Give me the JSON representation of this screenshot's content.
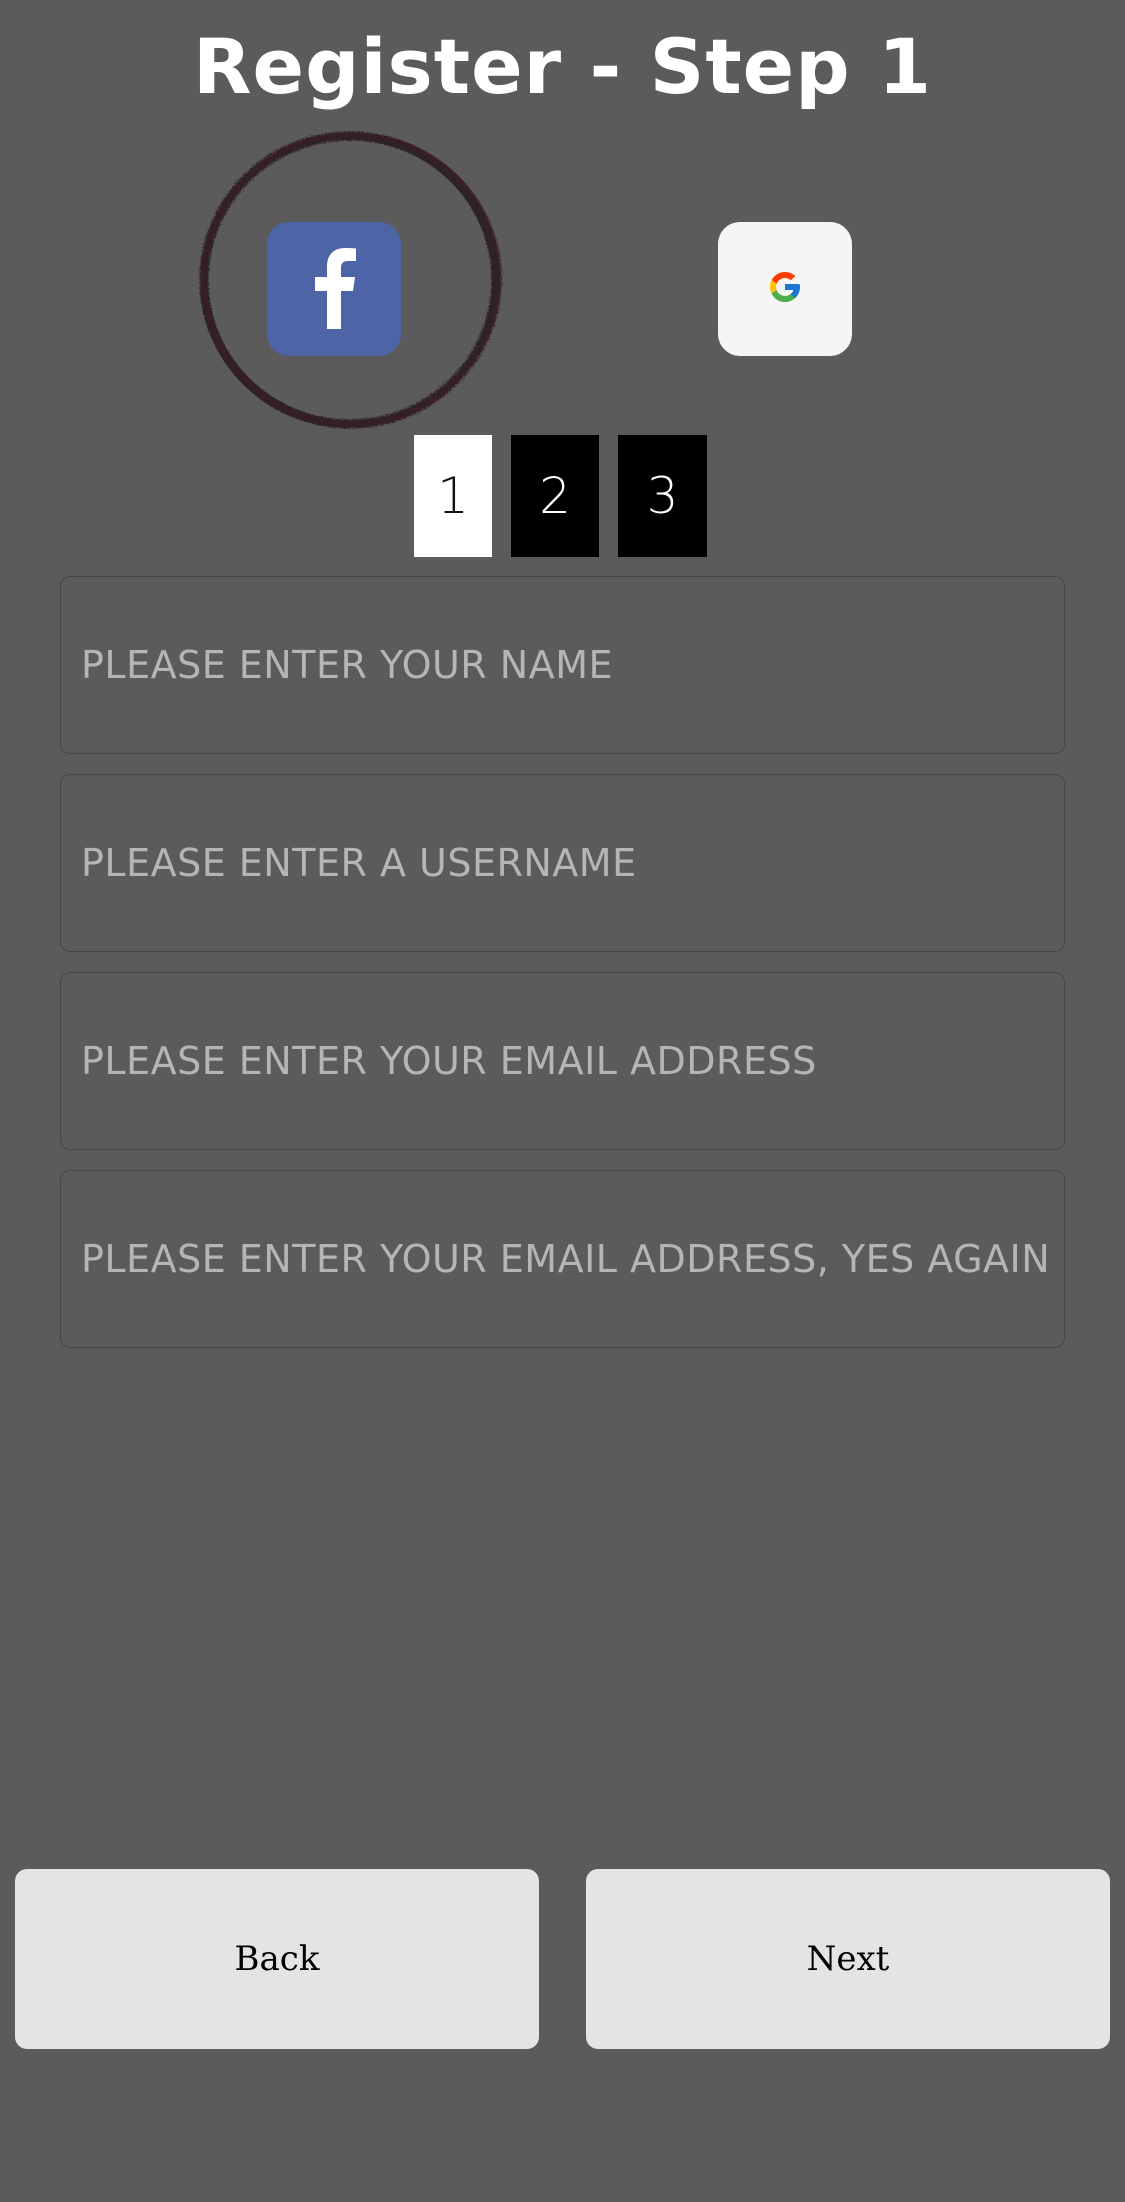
{
  "header": {
    "title": "Register - Step 1"
  },
  "social": {
    "facebook_icon": "facebook-f-icon",
    "google_icon": "google-g-icon",
    "colors": {
      "facebook": "#4d65a6",
      "google_bg": "#f5f5f5"
    }
  },
  "steps": {
    "items": [
      "1",
      "2",
      "3"
    ],
    "active": "1"
  },
  "form": {
    "name_placeholder": "PLEASE ENTER YOUR NAME",
    "username_placeholder": "PLEASE ENTER A USERNAME",
    "email_placeholder": "PLEASE ENTER YOUR EMAIL ADDRESS",
    "email_confirm_placeholder": "PLEASE ENTER YOUR EMAIL ADDRESS, YES AGAIN"
  },
  "nav": {
    "back_label": "Back",
    "next_label": "Next"
  }
}
